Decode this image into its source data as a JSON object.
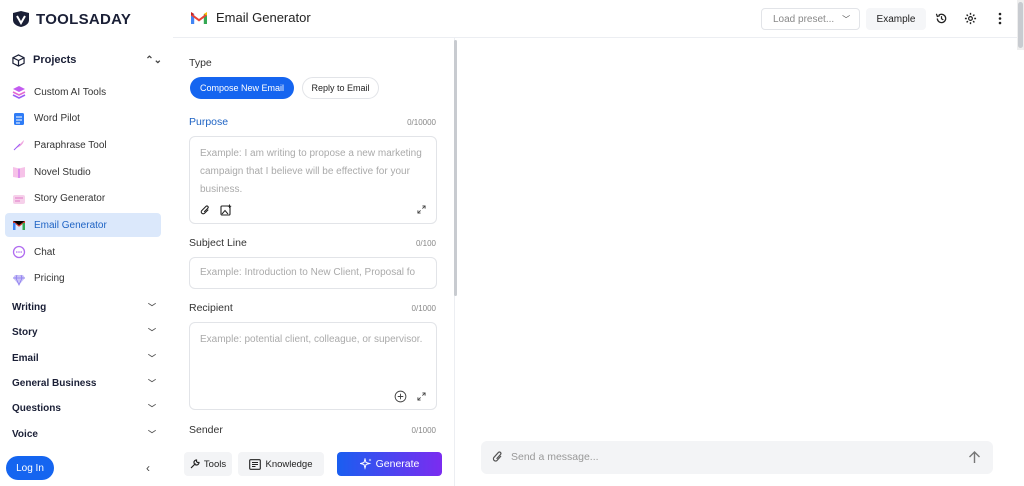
{
  "brand": {
    "name": "TOOLSADAY"
  },
  "sidebar": {
    "projects_label": "Projects",
    "items": [
      {
        "label": "Custom AI Tools",
        "icon": "layers-icon"
      },
      {
        "label": "Word Pilot",
        "icon": "document-icon"
      },
      {
        "label": "Paraphrase Tool",
        "icon": "quill-icon"
      },
      {
        "label": "Novel Studio",
        "icon": "book-icon"
      },
      {
        "label": "Story Generator",
        "icon": "story-icon"
      },
      {
        "label": "Email Generator",
        "icon": "gmail-icon",
        "active": true
      },
      {
        "label": "Chat",
        "icon": "chat-bubble-icon"
      },
      {
        "label": "Pricing",
        "icon": "gem-icon"
      }
    ],
    "categories": [
      "Writing",
      "Story",
      "Email",
      "General Business",
      "Questions",
      "Voice"
    ],
    "login_label": "Log In"
  },
  "header": {
    "title": "Email Generator",
    "preset_placeholder": "Load preset...",
    "example_label": "Example"
  },
  "form": {
    "type_label": "Type",
    "type_options": [
      "Compose New Email",
      "Reply to Email"
    ],
    "purpose": {
      "label": "Purpose",
      "count": "0/10000",
      "placeholder": "Example: I am writing to propose a new marketing campaign that I believe will be effective for your business."
    },
    "subject": {
      "label": "Subject Line",
      "count": "0/100",
      "placeholder": "Example: Introduction to New Client, Proposal fo"
    },
    "recipient": {
      "label": "Recipient",
      "count": "0/1000",
      "placeholder": "Example: potential client, colleague, or supervisor."
    },
    "sender": {
      "label": "Sender",
      "count": "0/1000"
    },
    "tools_label": "Tools",
    "knowledge_label": "Knowledge",
    "generate_label": "Generate"
  },
  "chat": {
    "placeholder": "Send a message..."
  },
  "colors": {
    "primary": "#1565f0",
    "active_bg": "#dbe8fb",
    "active_text": "#1e63c4",
    "generate_gradient_end": "#7b2cf0"
  }
}
